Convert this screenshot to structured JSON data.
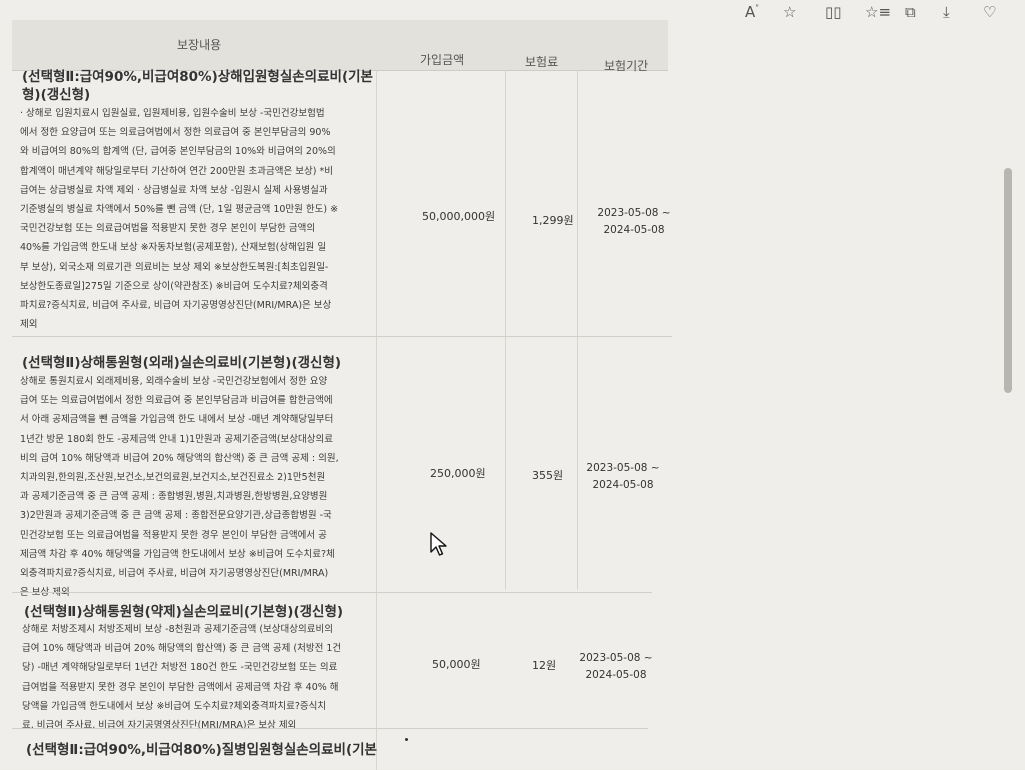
{
  "header": {
    "col_coverage": "보장내용",
    "col_amount": "가입금액",
    "col_premium": "보험료",
    "col_period": "보험기간"
  },
  "rows": [
    {
      "title_1": "(선택형Ⅱ:급여90%,비급여80%)상해입원형실손의료비(기본",
      "title_2": "형)(갱신형)",
      "desc": "· 상해로 입원치료시 입원실료, 입원제비용, 입원수술비 보상 -국민건강보험법\n에서 정한 요양급여 또는 의료급여법에서 정한 의료급여 중 본인부담금의 90%\n와 비급여의 80%의 합계액 (단, 급여중 본인부담금의 10%와 비급여의 20%의\n합계액이 매년계약 해당일로부터 기산하여 연간 200만원 초과금액은 보상) *비\n급여는 상급병실료 차액 제외 · 상급병실료 차액 보상 -입원시 실제 사용병실과\n기준병실의 병실료 차액에서 50%를 뺀 금액 (단, 1일 평균금액 10만원 한도) ※\n국민건강보험 또는 의료급여법을 적용받지 못한 경우 본인이 부담한 금액의\n40%를 가입금액 한도내 보상 ※자동차보험(공제포함), 산재보험(상해입원 일\n부 보상), 외국소재 의료기관 의료비는 보상 제외 ※보상한도복원:[최초입원일-\n보상한도종료일]275일 기준으로 상이(약관참조) ※비급여 도수치료?체외충격\n파치료?증식치료, 비급여 주사료, 비급여 자기공명영상진단(MRI/MRA)은 보상\n제외",
      "amount": "50,000,000원",
      "premium": "1,299원",
      "period_1": "2023-05-08 ~",
      "period_2": "2024-05-08"
    },
    {
      "title_1": "(선택형Ⅱ)상해통원형(외래)실손의료비(기본형)(갱신형)",
      "title_2": "",
      "desc": "상해로 통원치료시 외래제비용, 외래수술비 보상 -국민건강보험에서 정한 요양\n급여 또는 의료급여법에서 정한 의료급여 중 본인부담금과 비급여를 합한금액에\n서 아래 공제금액을 뺀 금액을 가입금액 한도 내에서 보상 -매년 계약해당일부터\n1년간 방문 180회 한도 -공제금액 안내 1)1만원과 공제기준금액(보상대상의료\n비의 급여 10% 해당액과 비급여 20% 해당액의 합산액) 중 큰 금액 공제 : 의원,\n치과의원,한의원,조산원,보건소,보건의료원,보건지소,보건진료소 2)1만5천원\n과 공제기준금액 중 큰 금액 공제 : 종합병원,병원,치과병원,한방병원,요양병원\n3)2만원과 공제기준금액 중 큰 금액 공제 : 종합전문요양기관,상급종합병원 -국\n민건강보험 또는 의료급여법을 적용받지 못한 경우 본인이 부담한 금액에서 공\n제금액 차감 후 40% 해당액을 가입금액 한도내에서 보상 ※비급여 도수치료?체\n외충격파치료?증식치료, 비급여 주사료, 비급여 자기공명영상진단(MRI/MRA)\n은 보상 제외",
      "amount": "250,000원",
      "premium": "355원",
      "period_1": "2023-05-08 ~",
      "period_2": "2024-05-08"
    },
    {
      "title_1": "(선택형Ⅱ)상해통원형(약제)실손의료비(기본형)(갱신형)",
      "title_2": "",
      "desc": "상해로 처방조제시 처방조제비 보상 -8천원과 공제기준금액 (보상대상의료비의\n급여 10% 해당액과 비급여 20% 해당액의 합산액) 중 큰 금액 공제 (처방전 1건\n당) -매년 계약해당일로부터 1년간 처방전 180건 한도 -국민건강보험 또는 의료\n급여법을 적용받지 못한 경우 본인이 부담한 금액에서 공제금액 차감 후 40% 해\n당액을 가입금액 한도내에서 보상 ※비급여 도수치료?체외충격파치료?증식치\n료, 비급여 주사료, 비급여 자기공명영상진단(MRI/MRA)은 보상 제외",
      "amount": "50,000원",
      "premium": "12원",
      "period_1": "2023-05-08 ~",
      "period_2": "2024-05-08"
    },
    {
      "title_1": "(선택형Ⅱ:급여90%,비급여80%)질병입원형실손의료비(기본",
      "title_2": ""
    }
  ]
}
